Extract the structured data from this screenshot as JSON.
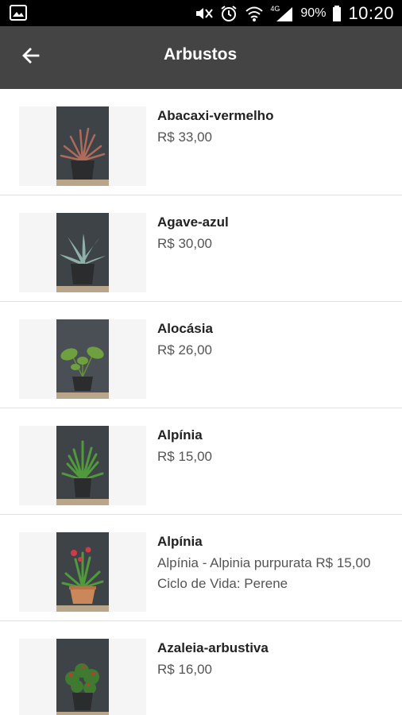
{
  "status_bar": {
    "battery_percent": "90%",
    "time": "10:20",
    "network": "4G",
    "icons": [
      "image-notification-icon",
      "mute-icon",
      "alarm-icon",
      "wifi-icon",
      "signal-icon",
      "battery-icon"
    ]
  },
  "app_bar": {
    "title": "Arbustos",
    "back_icon": "arrow-left-icon"
  },
  "products": [
    {
      "name": "Abacaxi-vermelho",
      "description": "R$ 33,00",
      "plant": "bromeliad-red"
    },
    {
      "name": "Agave-azul",
      "description": "R$ 30,00",
      "plant": "agave"
    },
    {
      "name": "Alocásia",
      "description": "R$ 26,00",
      "plant": "alocasia"
    },
    {
      "name": "Alpínia",
      "description": "R$ 15,00",
      "plant": "alpinia"
    },
    {
      "name": "Alpínia",
      "description": "Alpínia - Alpinia purpurata  R$ 15,00 Ciclo de Vida: Perene",
      "plant": "alpinia-red"
    },
    {
      "name": "Azaleia-arbustiva",
      "description": "R$ 16,00",
      "plant": "azalea"
    }
  ],
  "colors": {
    "status_bar": "#000000",
    "app_bar": "#444444",
    "photo_background": "#3e4348",
    "divider": "#e0e0e0"
  }
}
